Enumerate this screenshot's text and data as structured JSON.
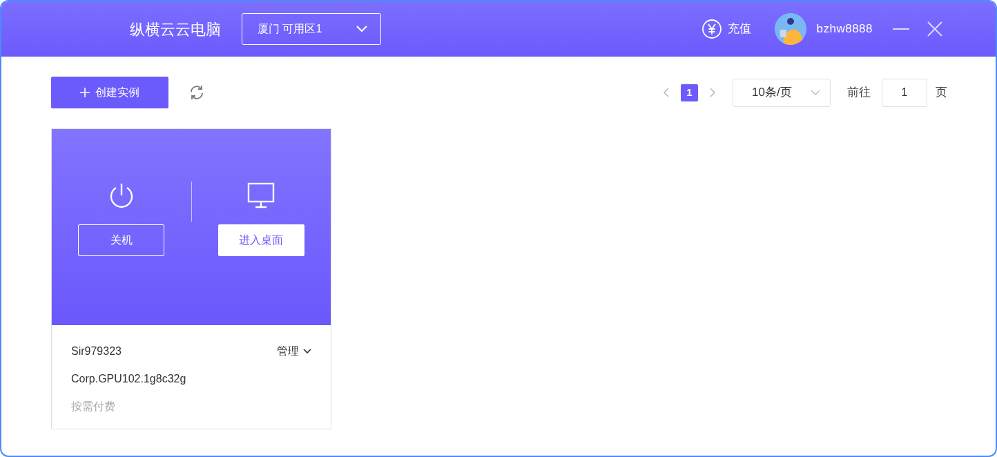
{
  "window": {
    "title": "纵横云云电脑"
  },
  "region_select": {
    "value": "厦门 可用区1"
  },
  "recharge": {
    "label": "充值"
  },
  "user": {
    "name": "bzhw8888"
  },
  "toolbar": {
    "create_label": "创建实例"
  },
  "pagination": {
    "pages": [
      {
        "label": "1",
        "selected": true
      }
    ],
    "page_size": "10条/页",
    "goto_label": "前往",
    "goto_value": "1",
    "page_suffix": "页"
  },
  "instances": [
    {
      "actions": [
        {
          "kind": "power",
          "label": "关机"
        },
        {
          "kind": "desktop",
          "label": "进入桌面"
        }
      ],
      "name": "Sir979323",
      "manage_label": "管理",
      "spec": "Corp.GPU102.1g8c32g",
      "billing": "按需付费"
    }
  ]
}
